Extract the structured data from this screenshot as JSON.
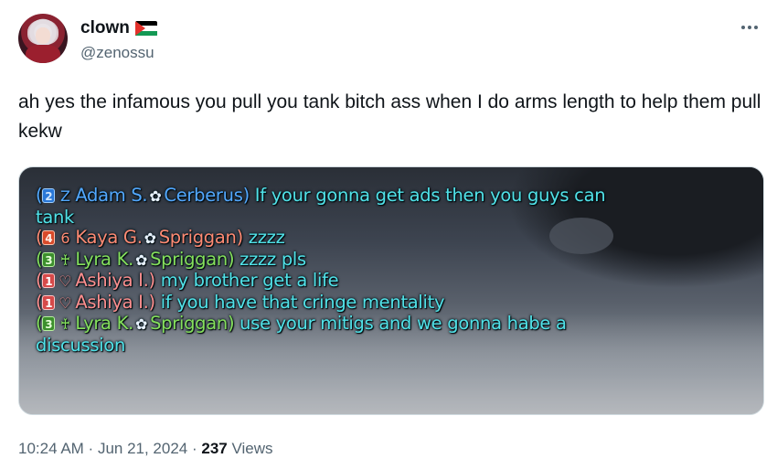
{
  "author": {
    "display_name": "clown",
    "handle": "@zenossu",
    "flag_icon": "palestine-flag-icon"
  },
  "tweet": {
    "text": "ah yes the infamous you pull you tank bitch ass when I do arms length to help them pull kekw"
  },
  "chat": {
    "lines": [
      {
        "open": "(",
        "badge": "2",
        "job_icon": "Z",
        "name": "Adam S.",
        "server": "Cerberus",
        "close": ")",
        "message": "If your gonna get ads then you guys can",
        "continuation": "tank"
      },
      {
        "open": "(",
        "badge": "4",
        "job_icon": "6",
        "name": "Kaya G.",
        "server": "Spriggan",
        "close": ")",
        "message": "zzzz"
      },
      {
        "open": "(",
        "badge": "3",
        "job_icon": "♰",
        "name": "Lyra K.",
        "server": "Spriggan",
        "close": ")",
        "message": "zzzz pls"
      },
      {
        "open": "(",
        "badge": "1",
        "job_icon": "♡",
        "name": "Ashiya I.",
        "close": ")",
        "message": "my brother get a life"
      },
      {
        "open": "(",
        "badge": "1",
        "job_icon": "♡",
        "name": "Ashiya I.",
        "close": ")",
        "message": "if you have that cringe mentality"
      },
      {
        "open": "(",
        "badge": "3",
        "job_icon": "♰",
        "name": "Lyra K.",
        "server": "Spriggan",
        "close": ")",
        "message": "use your mitigs and we gonna habe a",
        "continuation": "discussion"
      }
    ],
    "server_icon": "✿",
    "colors": {
      "party_blue": "#53a8ff",
      "party_red": "#ff8a73",
      "party_green": "#86e05c",
      "party_pink": "#ff8f8f",
      "message": "#51e2e8"
    }
  },
  "meta": {
    "time": "10:24 AM",
    "sep1": " · ",
    "date": "Jun 21, 2024",
    "sep2": " · ",
    "views_count": "237",
    "views_label": " Views"
  }
}
